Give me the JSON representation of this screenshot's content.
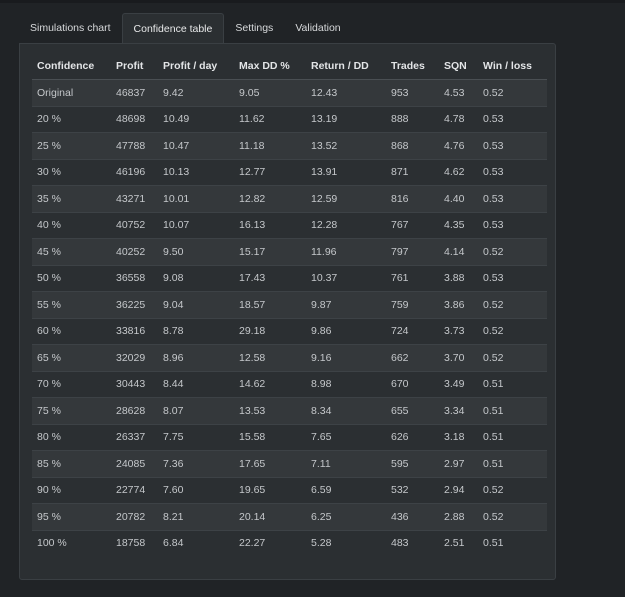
{
  "tabs": [
    {
      "label": "Simulations chart",
      "active": false
    },
    {
      "label": "Confidence table",
      "active": true
    },
    {
      "label": "Settings",
      "active": false
    },
    {
      "label": "Validation",
      "active": false
    }
  ],
  "table": {
    "columns": [
      "Confidence",
      "Profit",
      "Profit / day",
      "Max DD %",
      "Return / DD",
      "Trades",
      "SQN",
      "Win / loss"
    ],
    "rows": [
      [
        "Original",
        "46837",
        "9.42",
        "9.05",
        "12.43",
        "953",
        "4.53",
        "0.52"
      ],
      [
        "20 %",
        "48698",
        "10.49",
        "11.62",
        "13.19",
        "888",
        "4.78",
        "0.53"
      ],
      [
        "25 %",
        "47788",
        "10.47",
        "11.18",
        "13.52",
        "868",
        "4.76",
        "0.53"
      ],
      [
        "30 %",
        "46196",
        "10.13",
        "12.77",
        "13.91",
        "871",
        "4.62",
        "0.53"
      ],
      [
        "35 %",
        "43271",
        "10.01",
        "12.82",
        "12.59",
        "816",
        "4.40",
        "0.53"
      ],
      [
        "40 %",
        "40752",
        "10.07",
        "16.13",
        "12.28",
        "767",
        "4.35",
        "0.53"
      ],
      [
        "45 %",
        "40252",
        "9.50",
        "15.17",
        "11.96",
        "797",
        "4.14",
        "0.52"
      ],
      [
        "50 %",
        "36558",
        "9.08",
        "17.43",
        "10.37",
        "761",
        "3.88",
        "0.53"
      ],
      [
        "55 %",
        "36225",
        "9.04",
        "18.57",
        "9.87",
        "759",
        "3.86",
        "0.52"
      ],
      [
        "60 %",
        "33816",
        "8.78",
        "29.18",
        "9.86",
        "724",
        "3.73",
        "0.52"
      ],
      [
        "65 %",
        "32029",
        "8.96",
        "12.58",
        "9.16",
        "662",
        "3.70",
        "0.52"
      ],
      [
        "70 %",
        "30443",
        "8.44",
        "14.62",
        "8.98",
        "670",
        "3.49",
        "0.51"
      ],
      [
        "75 %",
        "28628",
        "8.07",
        "13.53",
        "8.34",
        "655",
        "3.34",
        "0.51"
      ],
      [
        "80 %",
        "26337",
        "7.75",
        "15.58",
        "7.65",
        "626",
        "3.18",
        "0.51"
      ],
      [
        "85 %",
        "24085",
        "7.36",
        "17.65",
        "7.11",
        "595",
        "2.97",
        "0.51"
      ],
      [
        "90 %",
        "22774",
        "7.60",
        "19.65",
        "6.59",
        "532",
        "2.94",
        "0.52"
      ],
      [
        "95 %",
        "20782",
        "8.21",
        "20.14",
        "6.25",
        "436",
        "2.88",
        "0.52"
      ],
      [
        "100 %",
        "18758",
        "6.84",
        "22.27",
        "5.28",
        "483",
        "2.51",
        "0.51"
      ]
    ]
  }
}
